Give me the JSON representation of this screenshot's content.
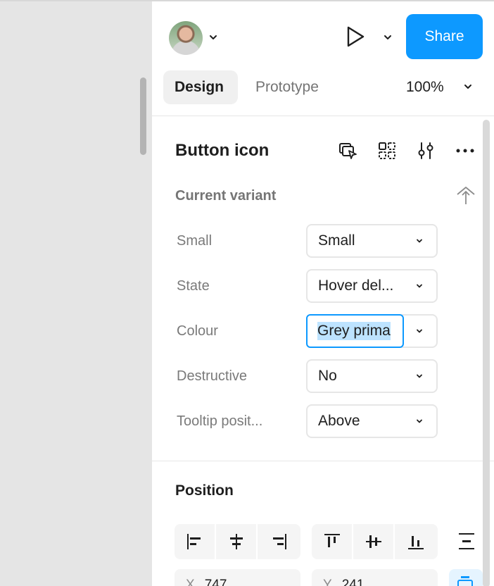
{
  "header": {
    "share_label": "Share",
    "zoom_label": "100%"
  },
  "tabs": [
    {
      "label": "Design"
    },
    {
      "label": "Prototype"
    }
  ],
  "component": {
    "title": "Button icon",
    "current_variant_label": "Current variant",
    "properties": [
      {
        "label": "Small",
        "value": "Small"
      },
      {
        "label": "State",
        "value": "Hover del..."
      },
      {
        "label": "Colour",
        "value": "Grey prima"
      },
      {
        "label": "Destructive",
        "value": "No"
      },
      {
        "label": "Tooltip posit...",
        "value": "Above"
      }
    ]
  },
  "position": {
    "title": "Position",
    "x_label": "X",
    "x_value": "747",
    "y_label": "Y",
    "y_value": "241"
  },
  "colors": {
    "accent": "#0d99ff",
    "selection": "#bde3ff"
  }
}
